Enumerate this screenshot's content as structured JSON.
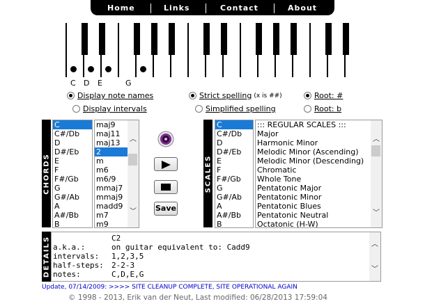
{
  "nav": {
    "home": "Home",
    "links": "Links",
    "contact": "Contact",
    "about": "About"
  },
  "keyboard": {
    "labels": [
      "C",
      "D",
      "E",
      "G"
    ]
  },
  "options": {
    "display_note_names": "Display note names",
    "display_intervals": "Display intervals",
    "strict_spelling": "Strict spelling",
    "strict_note": "(x is ##)",
    "simplified_spelling": "Simplified spelling",
    "root_sharp": "Root: #",
    "root_flat": "Root: b"
  },
  "labels": {
    "chords": "CHORDS",
    "scales": "SCALES",
    "details": "DETAILS"
  },
  "chord_roots": [
    "C",
    "C#/Db",
    "D",
    "D#/Eb",
    "E",
    "F",
    "F#/Gb",
    "G",
    "G#/Ab",
    "A",
    "A#/Bb",
    "B"
  ],
  "chord_types": [
    "maj9",
    "maj11",
    "maj13",
    "2",
    "m",
    "m6",
    "m6/9",
    "mmaj7",
    "mmaj9",
    "madd9",
    "m7",
    "m9"
  ],
  "controls": {
    "save": "Save",
    "speaker_icon": "speaker-icon"
  },
  "scale_roots": [
    "C",
    "C#/Db",
    "D",
    "D#/Eb",
    "E",
    "F",
    "F#/Gb",
    "G",
    "G#/Ab",
    "A",
    "A#/Bb",
    "B"
  ],
  "scale_types": [
    "::: REGULAR SCALES :::",
    "Major",
    "Harmonic Minor",
    "Melodic Minor (Ascending)",
    "Melodic Minor (Descending)",
    "Chromatic",
    "Whole Tone",
    "Pentatonic Major",
    "Pentatonic Minor",
    "Pentatonic Blues",
    "Pentatonic Neutral",
    "Octatonic (H-W)"
  ],
  "details": {
    "name": "C2",
    "aka_label": "a.k.a.:",
    "aka_value": "on guitar equivalent to: Cadd9",
    "intervals_label": "intervals:",
    "intervals_value": "1,2,3,5",
    "halfsteps_label": "half-steps:",
    "halfsteps_value": "2-2-3",
    "notes_label": "notes:",
    "notes_value": "C,D,E,G"
  },
  "update": "Update, 07/14/2009: >>>> SITE CLEANUP COMPLETE, SITE OPERATIONAL AGAIN",
  "copyright": "© 1998 - 2013, Erik van der Neut, Last modified: 06/28/2013 17:59:04",
  "colors": {
    "selection": "#1a7ad8",
    "link": "#0000cc"
  }
}
